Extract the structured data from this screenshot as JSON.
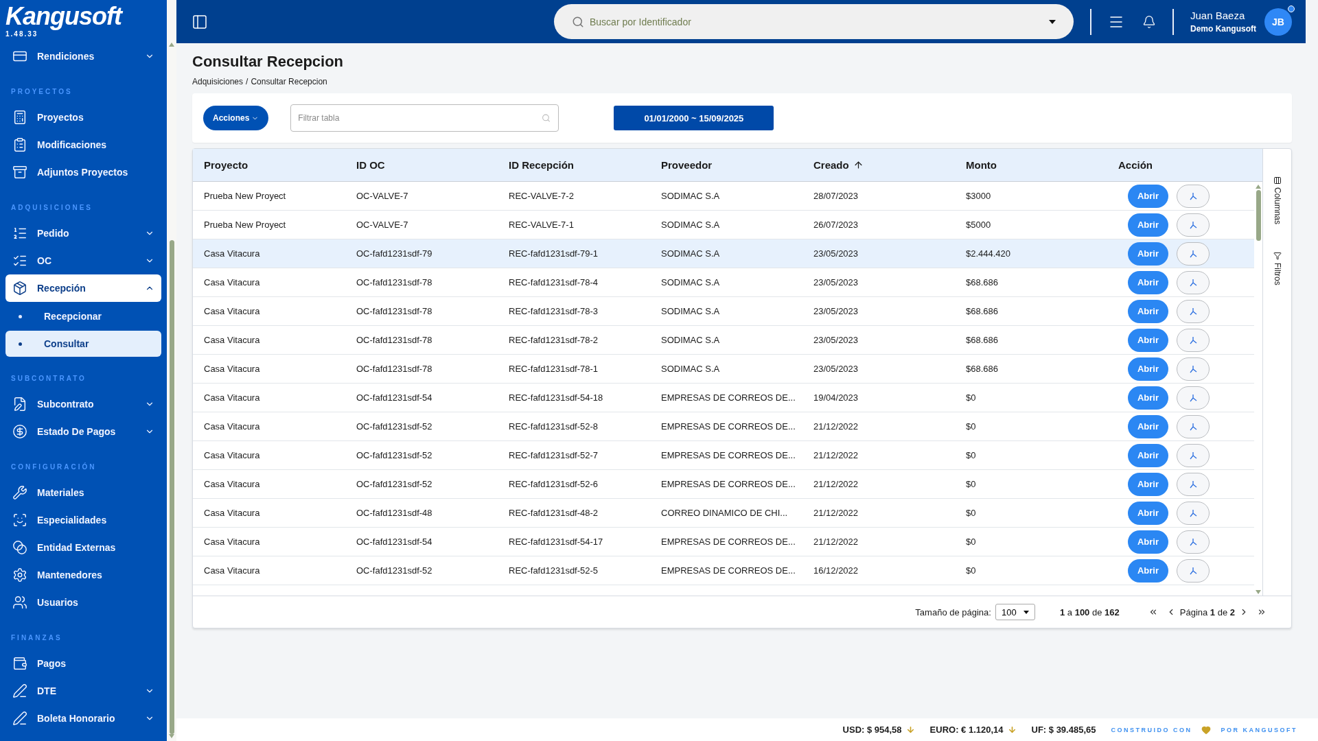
{
  "sidebar": {
    "logo": "Kangusoft",
    "version": "1.48.33",
    "groups": [
      {
        "items": [
          {
            "label": "Rendiciones",
            "selected": false,
            "expanded": false
          }
        ]
      },
      {
        "label": "PROYECTOS",
        "items": [
          {
            "label": "Proyectos",
            "selected": false
          },
          {
            "label": "Modificaciones",
            "selected": false
          },
          {
            "label": "Adjuntos Proyectos",
            "selected": false
          }
        ]
      },
      {
        "label": "ADQUISICIONES",
        "items": [
          {
            "label": "Pedido",
            "selected": false,
            "expanded": false
          },
          {
            "label": "OC",
            "selected": false,
            "expanded": false
          },
          {
            "label": "Recepción",
            "selected": true,
            "expanded": true,
            "children": [
              {
                "label": "Recepcionar",
                "selected": false
              },
              {
                "label": "Consultar",
                "selected": true
              }
            ]
          }
        ]
      },
      {
        "label": "SUBCONTRATO",
        "items": [
          {
            "label": "Subcontrato",
            "selected": false,
            "expanded": false
          },
          {
            "label": "Estado De Pagos",
            "selected": false,
            "expanded": false
          }
        ]
      },
      {
        "label": "CONFIGURACIÓN",
        "items": [
          {
            "label": "Materiales",
            "selected": false
          },
          {
            "label": "Especialidades",
            "selected": false
          },
          {
            "label": "Entidad Externas",
            "selected": false
          },
          {
            "label": "Mantenedores",
            "selected": false
          },
          {
            "label": "Usuarios",
            "selected": false
          }
        ]
      },
      {
        "label": "FINANZAS",
        "items": [
          {
            "label": "Pagos",
            "selected": false
          },
          {
            "label": "DTE",
            "selected": false,
            "expanded": false
          },
          {
            "label": "Boleta Honorario",
            "selected": false,
            "expanded": false
          }
        ]
      }
    ]
  },
  "topbar": {
    "search": {
      "placeholder": "Buscar por Identificador"
    },
    "user": {
      "name": "Juan Baeza",
      "company": "Demo Kangusoft",
      "initials": "JB"
    }
  },
  "page": {
    "title": "Consultar Recepcion",
    "breadcrumb": {
      "items": [
        "Adquisiciones",
        "Consultar Recepcion"
      ],
      "separator": "/"
    }
  },
  "toolbar": {
    "actions": "Acciones",
    "filter": {
      "placeholder": "Filtrar tabla"
    },
    "date_range": "01/01/2000 ~ 15/09/2025"
  },
  "table": {
    "columns": [
      {
        "label": "Proyecto",
        "sorted": false
      },
      {
        "label": "ID OC",
        "sorted": false
      },
      {
        "label": "ID Recepción",
        "sorted": false
      },
      {
        "label": "Proveedor",
        "sorted": false
      },
      {
        "label": "Creado",
        "sorted": true
      },
      {
        "label": "Monto",
        "sorted": false
      },
      {
        "label": "Acción",
        "sorted": false
      }
    ],
    "rows": [
      {
        "cells": [
          "Prueba New Proyect",
          "OC-VALVE-7",
          "REC-VALVE-7-2",
          "SODIMAC S.A",
          "28/07/2023",
          "$3000"
        ],
        "action": "Abrir",
        "selected": false
      },
      {
        "cells": [
          "Prueba New Proyect",
          "OC-VALVE-7",
          "REC-VALVE-7-1",
          "SODIMAC S.A",
          "26/07/2023",
          "$5000"
        ],
        "action": "Abrir",
        "selected": false
      },
      {
        "cells": [
          "Casa Vitacura",
          "OC-fafd1231sdf-79",
          "REC-fafd1231sdf-79-1",
          "SODIMAC S.A",
          "23/05/2023",
          "$2.444.420"
        ],
        "action": "Abrir",
        "selected": true
      },
      {
        "cells": [
          "Casa Vitacura",
          "OC-fafd1231sdf-78",
          "REC-fafd1231sdf-78-4",
          "SODIMAC S.A",
          "23/05/2023",
          "$68.686"
        ],
        "action": "Abrir",
        "selected": false
      },
      {
        "cells": [
          "Casa Vitacura",
          "OC-fafd1231sdf-78",
          "REC-fafd1231sdf-78-3",
          "SODIMAC S.A",
          "23/05/2023",
          "$68.686"
        ],
        "action": "Abrir",
        "selected": false
      },
      {
        "cells": [
          "Casa Vitacura",
          "OC-fafd1231sdf-78",
          "REC-fafd1231sdf-78-2",
          "SODIMAC S.A",
          "23/05/2023",
          "$68.686"
        ],
        "action": "Abrir",
        "selected": false
      },
      {
        "cells": [
          "Casa Vitacura",
          "OC-fafd1231sdf-78",
          "REC-fafd1231sdf-78-1",
          "SODIMAC S.A",
          "23/05/2023",
          "$68.686"
        ],
        "action": "Abrir",
        "selected": false
      },
      {
        "cells": [
          "Casa Vitacura",
          "OC-fafd1231sdf-54",
          "REC-fafd1231sdf-54-18",
          "EMPRESAS DE CORREOS DE...",
          "19/04/2023",
          "$0"
        ],
        "action": "Abrir",
        "selected": false
      },
      {
        "cells": [
          "Casa Vitacura",
          "OC-fafd1231sdf-52",
          "REC-fafd1231sdf-52-8",
          "EMPRESAS DE CORREOS DE...",
          "21/12/2022",
          "$0"
        ],
        "action": "Abrir",
        "selected": false
      },
      {
        "cells": [
          "Casa Vitacura",
          "OC-fafd1231sdf-52",
          "REC-fafd1231sdf-52-7",
          "EMPRESAS DE CORREOS DE...",
          "21/12/2022",
          "$0"
        ],
        "action": "Abrir",
        "selected": false
      },
      {
        "cells": [
          "Casa Vitacura",
          "OC-fafd1231sdf-52",
          "REC-fafd1231sdf-52-6",
          "EMPRESAS DE CORREOS DE...",
          "21/12/2022",
          "$0"
        ],
        "action": "Abrir",
        "selected": false
      },
      {
        "cells": [
          "Casa Vitacura",
          "OC-fafd1231sdf-48",
          "REC-fafd1231sdf-48-2",
          "CORREO DINAMICO DE CHI...",
          "21/12/2022",
          "$0"
        ],
        "action": "Abrir",
        "selected": false
      },
      {
        "cells": [
          "Casa Vitacura",
          "OC-fafd1231sdf-54",
          "REC-fafd1231sdf-54-17",
          "EMPRESAS DE CORREOS DE...",
          "21/12/2022",
          "$0"
        ],
        "action": "Abrir",
        "selected": false
      },
      {
        "cells": [
          "Casa Vitacura",
          "OC-fafd1231sdf-52",
          "REC-fafd1231sdf-52-5",
          "EMPRESAS DE CORREOS DE...",
          "16/12/2022",
          "$0"
        ],
        "action": "Abrir",
        "selected": false
      }
    ],
    "side_tabs": [
      "Columnas",
      "Filtros"
    ],
    "pagination": {
      "page_size_label": "Tamaño de página:",
      "page_size": "100",
      "range": "**1** a **100** de **162**",
      "page": "Página **1** de **2**"
    }
  },
  "footer": {
    "rates": [
      {
        "text": "USD: $ 954,58",
        "falling": true
      },
      {
        "text": "EURO: € 1.120,14",
        "falling": true
      },
      {
        "text": "UF: $ 39.485,65",
        "falling": false
      }
    ],
    "credit": [
      "CONSTRUIDO CON",
      "POR KANGUSOFT"
    ]
  }
}
